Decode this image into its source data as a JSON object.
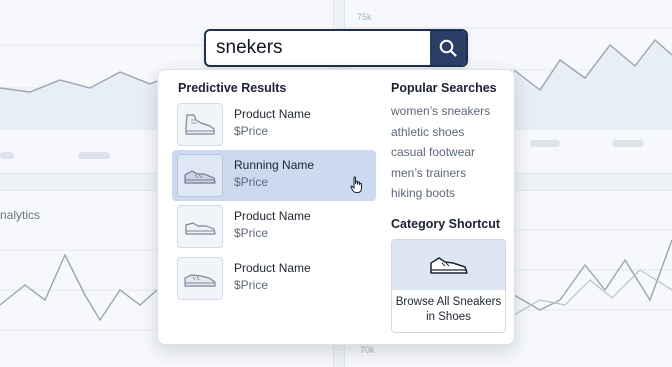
{
  "search": {
    "query": "snekers",
    "button_icon": "search-icon"
  },
  "dropdown": {
    "predictive_title": "Predictive Results",
    "results": [
      {
        "name": "Product Name",
        "price": "$Price",
        "icon": "high-top-sneaker-icon",
        "active": false
      },
      {
        "name": "Running Name",
        "price": "$Price",
        "icon": "running-shoe-icon",
        "active": true
      },
      {
        "name": "Product Name",
        "price": "$Price",
        "icon": "low-sneaker-icon",
        "active": false
      },
      {
        "name": "Product Name",
        "price": "$Price",
        "icon": "boat-shoe-icon",
        "active": false
      }
    ],
    "popular_title": "Popular Searches",
    "popular": [
      "women’s sneakers",
      "athletic shoes",
      "casual footwear",
      "men’s trainers",
      "hiking boots"
    ],
    "shortcut_title": "Category Shortcut",
    "shortcut": {
      "label": "Browse All Sneakers in Shoes",
      "icon": "sneaker-icon"
    }
  },
  "background": {
    "axis_top": "75k",
    "axis_bottom": "70k",
    "caption": "nalytics"
  },
  "colors": {
    "search_border": "#1f2f4f",
    "search_button": "#2b3f66",
    "active_row": "#ccd9f1",
    "chart_line": "#9aa4b3"
  }
}
